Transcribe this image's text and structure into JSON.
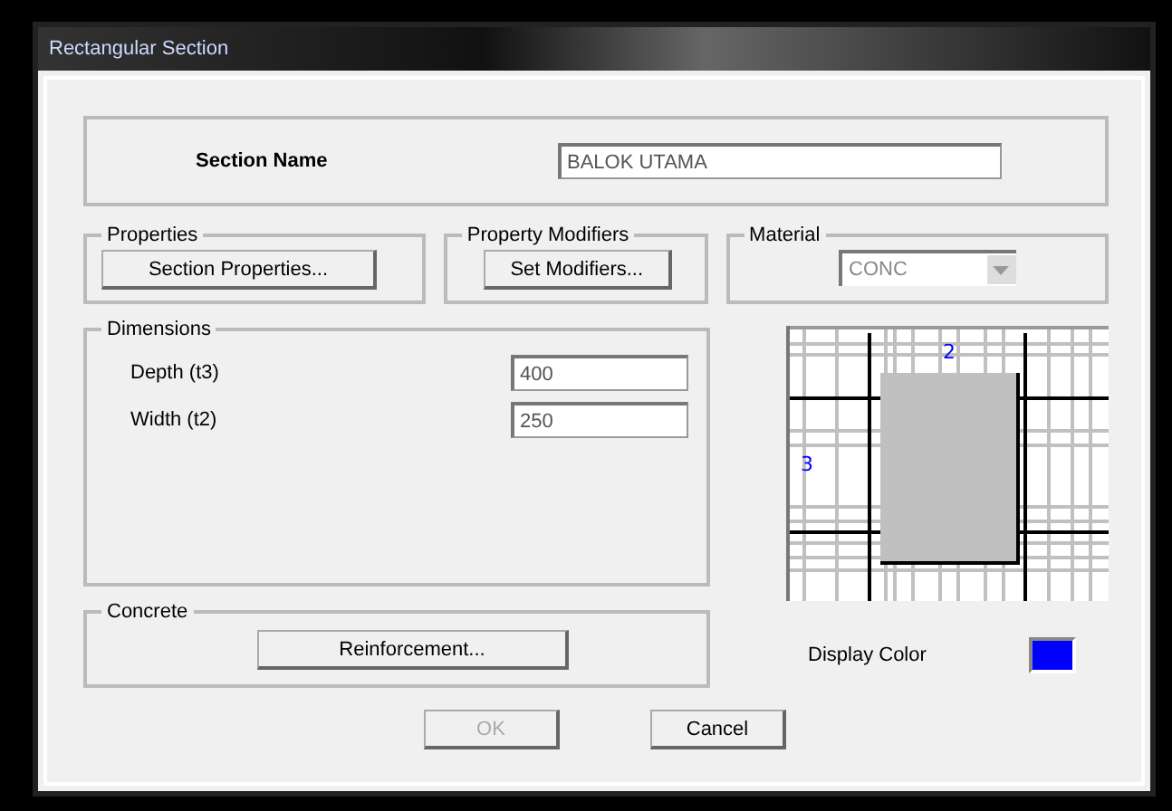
{
  "window": {
    "title": "Rectangular Section"
  },
  "section_name": {
    "label": "Section Name",
    "value": "BALOK UTAMA"
  },
  "properties": {
    "legend": "Properties",
    "button": "Section Properties..."
  },
  "property_modifiers": {
    "legend": "Property Modifiers",
    "button": "Set Modifiers..."
  },
  "material": {
    "legend": "Material",
    "value": "CONC",
    "disabled": true
  },
  "dimensions": {
    "legend": "Dimensions",
    "fields": [
      {
        "label": "Depth (t3)",
        "value": "400"
      },
      {
        "label": "Width (t2)",
        "value": "250"
      }
    ]
  },
  "preview": {
    "axis_labels": [
      "2",
      "3"
    ]
  },
  "concrete": {
    "legend": "Concrete",
    "button": "Reinforcement..."
  },
  "display_color": {
    "label": "Display Color",
    "color": "#0000ff"
  },
  "buttons": [
    {
      "label": "OK",
      "disabled": true
    },
    {
      "label": "Cancel",
      "disabled": false
    }
  ]
}
